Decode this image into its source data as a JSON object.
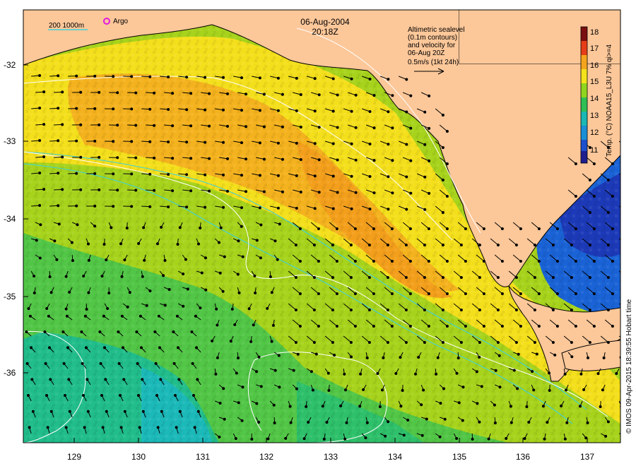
{
  "title": {
    "date": "06-Aug-2004",
    "time": "20:18Z"
  },
  "legend_top_left": {
    "isobaths": "200  1000m",
    "argo": "Argo"
  },
  "legend_top_right": {
    "line1": "Altimetric sealevel",
    "line2": "(0.1m contours)",
    "line3": "and velocity for",
    "line4": "06-Aug 20Z",
    "line5": "0.5m/s (1kt 24h)"
  },
  "colorbar": {
    "label": "Temp. (°C) NOAA15_L3U 7% qi>=4",
    "ticks": [
      "18",
      "17",
      "16",
      "15",
      "14",
      "13",
      "12",
      "11"
    ]
  },
  "axes": {
    "lat_labels": [
      "-32",
      "-33",
      "-34",
      "-35",
      "-36"
    ],
    "lon_labels": [
      "129",
      "130",
      "131",
      "132",
      "133",
      "134",
      "135",
      "136",
      "137"
    ]
  },
  "credit": "© IMOS 09-Apr-2015 18:39:55 Hobart time",
  "colors": {
    "land": "#fcc799",
    "warm": "#f39a1c",
    "mid": "#f2e21d",
    "cool": "#9ed81e",
    "green": "#2fc255",
    "teal": "#19bfa5",
    "blue": "#1463d9",
    "deepblue": "#1b2bb0",
    "argo_marker": "#e019e0",
    "isobath_line": "#3fd2d8",
    "contour_line": "#ffffff"
  }
}
